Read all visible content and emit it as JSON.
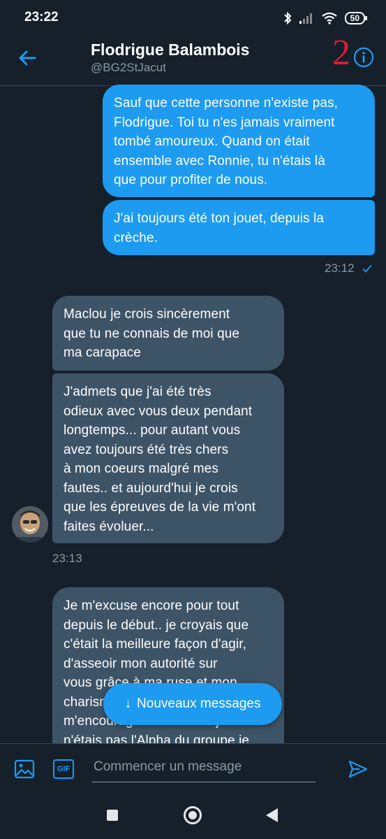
{
  "status_bar": {
    "time": "23:22",
    "battery": "50"
  },
  "header": {
    "name": "Flodrigue Balambois",
    "handle": "@BG2StJacut",
    "overlay_number": "2"
  },
  "messages": [
    {
      "direction": "out",
      "text": "Sauf que cette personne n'existe pas,\nFlodrigue. Toi tu n'es jamais vraiment\ntombé amoureux. Quand on était\nensemble avec Ronnie, tu n'étais là\nque pour profiter de nous."
    },
    {
      "direction": "out",
      "text": "J'ai toujours été ton jouet, depuis la\ncrèche."
    },
    {
      "direction": "in",
      "text": "Maclou je crois sincèrement\nque tu ne connais de moi que\nma carapace"
    },
    {
      "direction": "in",
      "text": "J'admets que j'ai été très\nodieux avec vous deux pendant\nlongtemps... pour autant vous\navez toujours été très chers\nà mon coeurs malgré mes\nfautes.. et aujourd'hui je crois\nque les épreuves de la vie m'ont\nfaites évoluer..."
    },
    {
      "direction": "in",
      "text": "Je m'excuse encore pour tout\ndepuis le début.. je croyais que\nc'était la meilleure façon d'agir,\nd'asseoir mon autorité sur\nvous grâce à ma ruse et mon\ncharisme... m'encourageait\nm'encourageait aussi à... j'en\nn'étais pas l'Alpha du groupe je"
    }
  ],
  "timestamps": {
    "out_group": "23:12",
    "in_group": "23:13"
  },
  "new_messages_label": "Nouveaux messages",
  "composer": {
    "placeholder": "Commencer un message",
    "gif_label": "GIF"
  },
  "colors": {
    "background": "#15202b",
    "accent": "#1d9bf0",
    "incoming_bubble": "#3d5466",
    "muted": "#8899a6",
    "overlay_red": "#e0192f"
  }
}
